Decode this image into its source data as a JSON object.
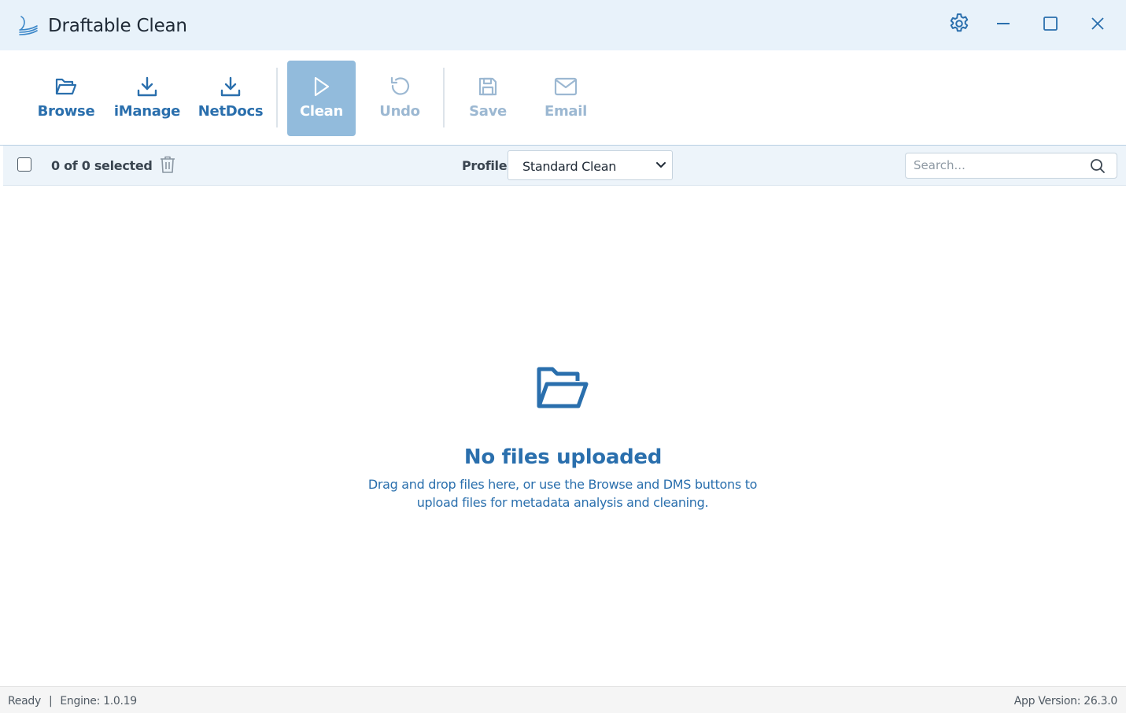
{
  "window": {
    "title": "Draftable Clean"
  },
  "titlebar": {
    "icons": [
      "settings-icon",
      "minimize-icon",
      "maximize-icon",
      "close-icon"
    ]
  },
  "toolbar": {
    "browse_label": "Browse",
    "imanage_label": "iManage",
    "netdocs_label": "NetDocs",
    "clean_label": "Clean",
    "undo_label": "Undo",
    "save_label": "Save",
    "email_label": "Email"
  },
  "filterbar": {
    "selection_text": "0 of 0 selected",
    "profile_label": "Profile:",
    "profile_value": "Standard Clean",
    "search_placeholder": "Search..."
  },
  "empty_state": {
    "title": "No files uploaded",
    "description": "Drag and drop files here, or use the Browse and DMS buttons to upload files for metadata analysis and cleaning."
  },
  "statusbar": {
    "status": "Ready",
    "separator": "|",
    "engine": "Engine: 1.0.19",
    "app_version": "App Version: 26.3.0"
  },
  "colors": {
    "accent": "#2a6fad",
    "titlebar_bg": "#e8f2fa",
    "primary_button_bg": "#92bbdc",
    "disabled_text": "#9cb8d2"
  }
}
